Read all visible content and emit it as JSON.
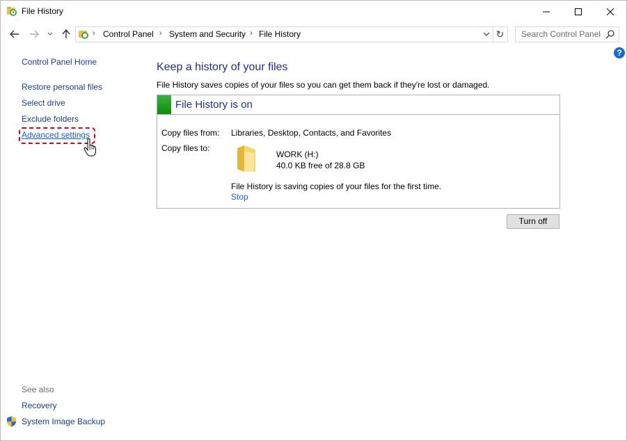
{
  "window": {
    "title": "File History"
  },
  "address": {
    "crumbs": [
      "Control Panel",
      "System and Security",
      "File History"
    ],
    "search_placeholder": "Search Control Panel"
  },
  "help": {
    "glyph": "?"
  },
  "sidebar": {
    "home": "Control Panel Home",
    "links": [
      "Restore personal files",
      "Select drive",
      "Exclude folders",
      "Advanced settings"
    ],
    "see_also_label": "See also",
    "see_also": [
      "Recovery",
      "System Image Backup"
    ]
  },
  "main": {
    "heading": "Keep a history of your files",
    "description": "File History saves copies of your files so you can get them back if they're lost or damaged.",
    "status_title": "File History is on",
    "copy_from_label": "Copy files from:",
    "copy_from_value": "Libraries, Desktop, Contacts, and Favorites",
    "copy_to_label": "Copy files to:",
    "drive_name": "WORK (H:)",
    "drive_space": "40.0 KB free of 28.8 GB",
    "saving_status": "File History is saving copies of your files for the first time.",
    "stop_link": "Stop",
    "turn_off_button": "Turn off"
  },
  "colors": {
    "link": "#1a3e84",
    "heading": "#1e3287",
    "status_green": "#1f9a1f",
    "highlight": "#e0000f"
  }
}
